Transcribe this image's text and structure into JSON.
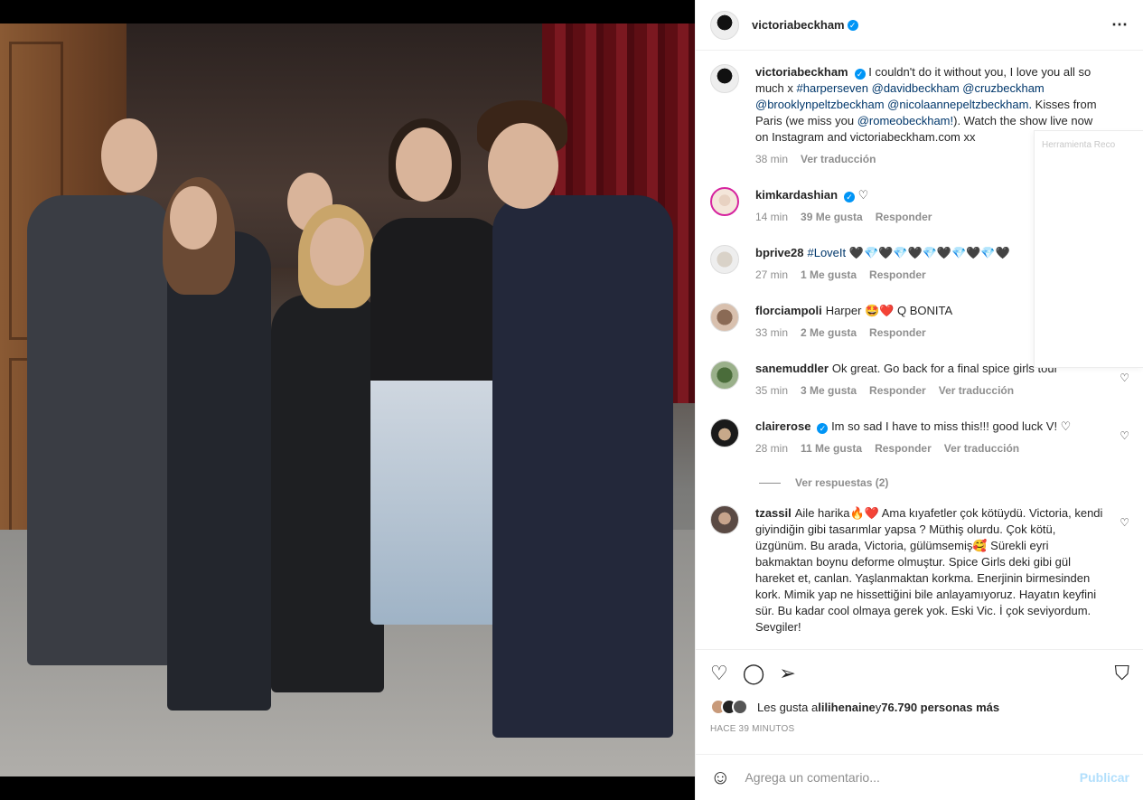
{
  "post": {
    "author": "victoriabeckham",
    "more_icon": "⋯"
  },
  "caption": {
    "username": "victoriabeckham",
    "text_1": "I couldn't do it without you, I love you all so much x ",
    "tags": "#harperseven @davidbeckham @cruzbeckham @brooklynpeltzbeckham @nicolaannepeltzbeckham.",
    "text_2": " Kisses from Paris (we miss you ",
    "mention": "@romeobeckham!",
    "text_3": "). Watch the show live now on Instagram and victoriabeckham.com xx",
    "time": "38 min",
    "translate": "Ver traducción"
  },
  "popup_text": "Herramienta Reco",
  "comments": [
    {
      "username": "kimkardashian",
      "verified": true,
      "text": "♡",
      "time": "14 min",
      "likes": "39 Me gusta",
      "reply": "Responder",
      "translate": ""
    },
    {
      "username": "bprive28",
      "verified": false,
      "tag": "#LoveIt",
      "text": " 🖤💎🖤💎🖤💎🖤💎🖤💎🖤",
      "time": "27 min",
      "likes": "1 Me gusta",
      "reply": "Responder",
      "translate": ""
    },
    {
      "username": "florciampoli",
      "verified": false,
      "text": "Harper 🤩❤️ Q BONITA",
      "time": "33 min",
      "likes": "2 Me gusta",
      "reply": "Responder",
      "translate": ""
    },
    {
      "username": "sanemuddler",
      "verified": false,
      "text": "Ok great. Go back for a final spice girls tour",
      "time": "35 min",
      "likes": "3 Me gusta",
      "reply": "Responder",
      "translate": "Ver traducción"
    },
    {
      "username": "clairerose",
      "verified": true,
      "text": "Im so sad I have to miss this!!! good luck V! ♡",
      "time": "28 min",
      "likes": "11 Me gusta",
      "reply": "Responder",
      "translate": "Ver traducción"
    }
  ],
  "replies_label": "Ver respuestas (2)",
  "long_comment": {
    "username": "tzassil",
    "text": "Aile harika🔥❤️ Ama kıyafetler çok kötüydü. Victoria, kendi giyindiğin gibi tasarımlar yapsa ? Müthiş olurdu. Çok kötü, üzgünüm. Bu arada, Victoria, gülümsemiş🥰 Sürekli eyri bakmaktan boynu deforme olmuştur. Spice Girls deki gibi gül hareket et, canlan. Yaşlanmaktan korkma. Enerjinin birmesinden kork. Mimik yap ne hissettiğini bile anlayamıyoruz. Hayatın keyfini sür. Bu kadar cool olmaya gerek yok. Eski Vic. İ çok seviyordum. Sevgiler!"
  },
  "actions": {
    "like_icon": "♡",
    "comment_icon": "◯",
    "share_icon": "➢",
    "save_icon": "⛉"
  },
  "likes": {
    "prefix": "Les gusta a ",
    "user": "lilihenaine",
    "middle": " y ",
    "count": "76.790 personas más"
  },
  "time_ago": "HACE 39 MINUTOS",
  "add_comment": {
    "emoji_icon": "☺",
    "placeholder": "Agrega un comentario...",
    "publish": "Publicar"
  }
}
